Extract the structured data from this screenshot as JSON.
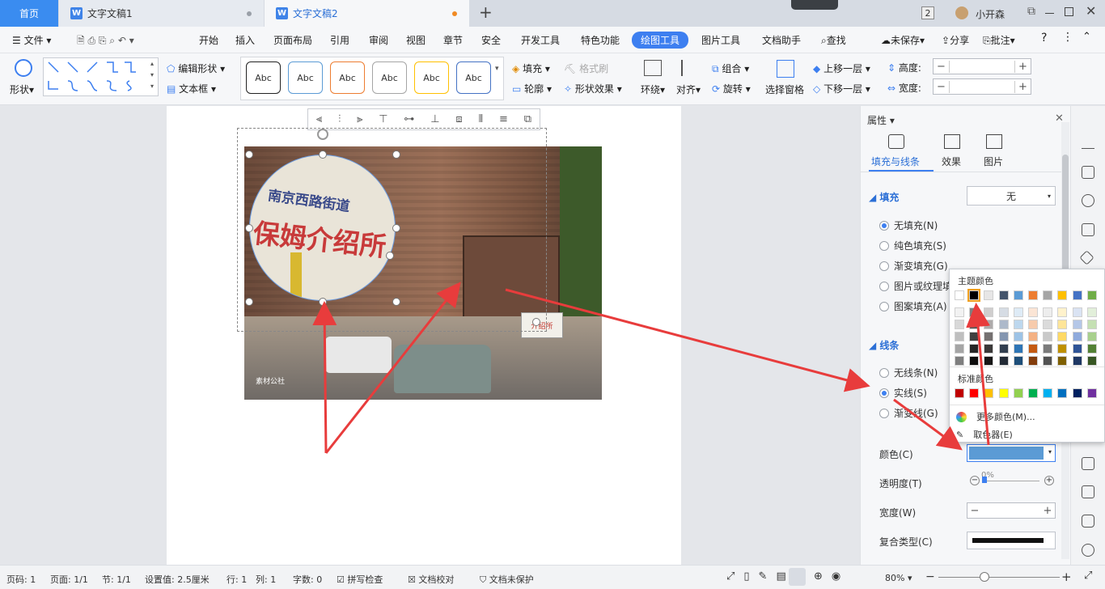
{
  "tabs": {
    "home": "首页",
    "doc1": "文字文稿1",
    "doc2": "文字文稿2",
    "add": "+"
  },
  "titlebar": {
    "badge": "2",
    "user": "小开森"
  },
  "menu": {
    "file": "文件",
    "items": [
      "开始",
      "插入",
      "页面布局",
      "引用",
      "审阅",
      "视图",
      "章节",
      "安全",
      "开发工具",
      "特色功能",
      "绘图工具",
      "图片工具",
      "文档助手"
    ],
    "search": "查找",
    "unsaved": "未保存",
    "share": "分享",
    "comment": "批注",
    "help": "?"
  },
  "ribbon": {
    "shape": "形状",
    "edit_shape": "编辑形状",
    "textbox": "文本框",
    "styles": [
      "Abc",
      "Abc",
      "Abc",
      "Abc",
      "Abc",
      "Abc"
    ],
    "style_colors": [
      "#222222",
      "#5b9bd5",
      "#ed7d31",
      "#a5a5a5",
      "#ffc000",
      "#4472c4"
    ],
    "fill": "填充",
    "format_brush": "格式刷",
    "outline": "轮廓",
    "shape_effect": "形状效果",
    "wrap": "环绕",
    "align": "对齐",
    "group": "组合",
    "rotate": "旋转",
    "selection_pane": "选择窗格",
    "bring_forward": "上移一层",
    "send_backward": "下移一层",
    "height": "高度:",
    "width": "宽度:"
  },
  "photo_text": {
    "sign_top": "南京西路街道",
    "sign_main": "保姆介绍所",
    "small_sign": "介绍所",
    "watermark": "素材公社"
  },
  "panel": {
    "title": "属性",
    "tabs": [
      "填充与线条",
      "效果",
      "图片"
    ],
    "fill_header": "填充",
    "fill_value": "无",
    "fill_options": [
      "无填充(N)",
      "纯色填充(S)",
      "渐变填充(G)",
      "图片或纹理填",
      "图案填充(A)"
    ],
    "line_header": "线条",
    "line_options": [
      "无线条(N)",
      "实线(S)",
      "渐变线(G)"
    ],
    "color_label": "颜色(C)",
    "color_value": "#5b9bd5",
    "transparency_label": "透明度(T)",
    "transparency_value": "0%",
    "width_label": "宽度(W)",
    "compound_label": "复合类型(C)"
  },
  "color_popup": {
    "theme_title": "主题颜色",
    "theme_row": [
      "#ffffff",
      "#000000",
      "#e7e6e6",
      "#44546a",
      "#5b9bd5",
      "#ed7d31",
      "#a5a5a5",
      "#ffc000",
      "#4472c4",
      "#70ad47"
    ],
    "shade_rows": [
      [
        "#f2f2f2",
        "#7f7f7f",
        "#d0cece",
        "#d6dce4",
        "#deebf6",
        "#fbe5d5",
        "#ededed",
        "#fff2cc",
        "#dae3f3",
        "#e2efda"
      ],
      [
        "#d8d8d8",
        "#595959",
        "#aeabab",
        "#adb9ca",
        "#bdd7ee",
        "#f7cbac",
        "#dbdbdb",
        "#fee599",
        "#b4c7e7",
        "#c5e0b3"
      ],
      [
        "#bfbfbf",
        "#3f3f3f",
        "#757070",
        "#8496b0",
        "#9dc3e6",
        "#f4b183",
        "#c9c9c9",
        "#ffd965",
        "#8faadc",
        "#a8d08d"
      ],
      [
        "#a5a5a5",
        "#262626",
        "#3a3838",
        "#323f4f",
        "#2e75b5",
        "#c55a11",
        "#7b7b7b",
        "#bf9000",
        "#2f5496",
        "#538135"
      ],
      [
        "#7f7f7f",
        "#0c0c0c",
        "#171616",
        "#222a35",
        "#1e4e79",
        "#833c0b",
        "#525252",
        "#7f6000",
        "#1f3864",
        "#375623"
      ]
    ],
    "standard_title": "标准颜色",
    "standard_row": [
      "#c00000",
      "#ff0000",
      "#ffc000",
      "#ffff00",
      "#92d050",
      "#00b050",
      "#00b0f0",
      "#0070c0",
      "#002060",
      "#7030a0"
    ],
    "more_colors": "更多颜色(M)...",
    "eyedropper": "取色器(E)"
  },
  "status": {
    "page_no": "页码: 1",
    "pages": "页面: 1/1",
    "section": "节: 1/1",
    "setting": "设置值: 2.5厘米",
    "row": "行: 1",
    "col": "列: 1",
    "words": "字数: 0",
    "spell": "拼写检查",
    "proof": "文档校对",
    "protect": "文档未保护",
    "zoom": "80%"
  },
  "accent": "#3d7ff0",
  "arrow_color": "#e83c3c"
}
